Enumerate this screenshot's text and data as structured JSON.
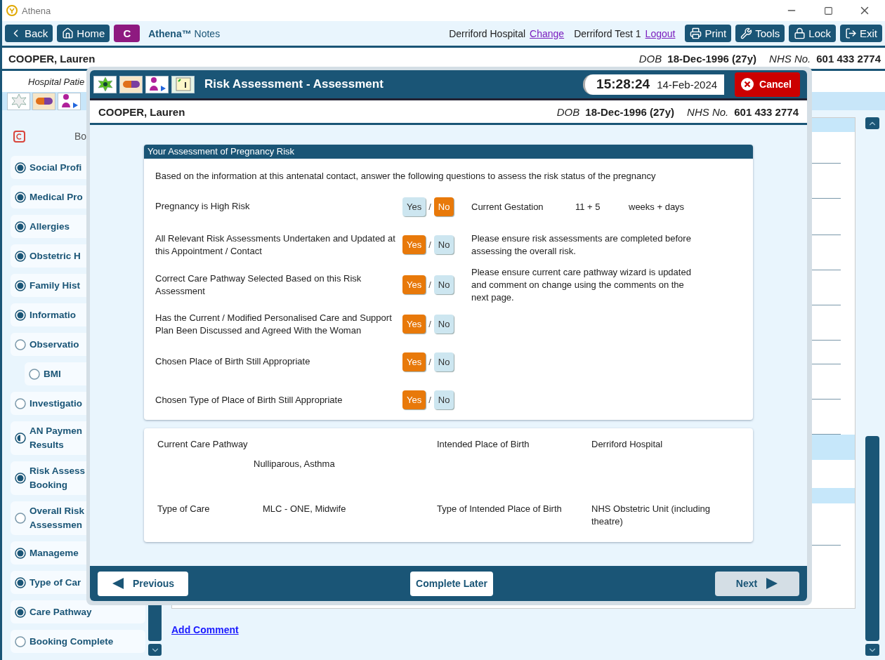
{
  "window": {
    "title": "Athena"
  },
  "toolbar": {
    "left_buttons": [
      {
        "label": "Back",
        "kind": "back"
      },
      {
        "label": "Home",
        "kind": "home"
      },
      {
        "label": "C",
        "kind": "letter"
      }
    ],
    "app_name": "**Athena™** Notes",
    "site": "Derriford Hospital",
    "site_link": "Change",
    "user": "Derriford Test 1",
    "user_link": "Logout",
    "right_buttons": [
      {
        "label": "Print",
        "kind": "print"
      },
      {
        "label": "Tools",
        "kind": "tools"
      },
      {
        "label": "Lock",
        "kind": "lock"
      },
      {
        "label": "Exit",
        "kind": "exit"
      }
    ]
  },
  "patient": {
    "name": "COOPER, Lauren",
    "dob_label": "DOB",
    "dob": "18-Dec-1996 (27y)",
    "nhs_label": "NHS No.",
    "nhs": "601 433 2774"
  },
  "subheading": "Hospital Patie",
  "sidebar": {
    "heading": "Bo",
    "items": [
      {
        "label": "Social Profi",
        "kind": "done"
      },
      {
        "label": "Medical Pro",
        "kind": "done"
      },
      {
        "label": "Allergies",
        "kind": "done"
      },
      {
        "label": "Obstetric H",
        "kind": "done"
      },
      {
        "label": "Family Hist",
        "kind": "done"
      },
      {
        "label": "Informatio",
        "kind": "done"
      },
      {
        "label": "Observatio",
        "kind": "empty",
        "children": [
          {
            "label": "BMI",
            "kind": "empty"
          }
        ]
      },
      {
        "label": "Investigatio",
        "kind": "empty"
      },
      {
        "label": "AN Paymen\nResults",
        "kind": "partial"
      },
      {
        "label": "Risk Assess\nBooking",
        "kind": "done"
      },
      {
        "label": "Overall Risk\nAssessmen",
        "kind": "empty"
      },
      {
        "label": "Manageme",
        "kind": "done"
      },
      {
        "label": "Type of Car",
        "kind": "done"
      },
      {
        "label": "Care Pathway",
        "kind": "done"
      },
      {
        "label": "Booking Complete",
        "kind": "empty"
      }
    ]
  },
  "add_comment": "Add Comment",
  "dialog": {
    "title": "Risk Assessment - Assessment",
    "time": "15:28:24",
    "date": "14-Feb-2024",
    "cancel": "Cancel",
    "patient": {
      "name": "COOPER, Lauren",
      "dob_label": "DOB",
      "dob": "18-Dec-1996 (27y)",
      "nhs_label": "NHS No.",
      "nhs": "601 433 2774"
    },
    "assessment": {
      "title": "Your Assessment of Pregnancy Risk",
      "intro": "Based on the information at this antenatal contact, answer the following questions to assess the risk status of the pregnancy",
      "questions": [
        {
          "label": "Pregnancy is High Risk",
          "separator": "/",
          "options": [
            {
              "label": "Yes",
              "selected": false
            },
            {
              "label": "No",
              "selected": true
            }
          ],
          "gestation": {
            "label": "Current Gestation",
            "value": "11 + 5",
            "unit": "weeks + days"
          }
        },
        {
          "label": "All Relevant Risk Assessments Undertaken and Updated at this Appointment / Contact",
          "separator": "/",
          "options": [
            {
              "label": "Yes",
              "selected": true
            },
            {
              "label": "No",
              "selected": false
            }
          ],
          "note": "Please ensure risk assessments are completed before assessing the overall risk."
        },
        {
          "label": "Correct Care Pathway Selected Based on this Risk Assessment",
          "separator": "/",
          "options": [
            {
              "label": "Yes",
              "selected": true
            },
            {
              "label": "No",
              "selected": false
            }
          ],
          "note": "Please ensure current care pathway wizard is updated and comment on change using the comments on the next page."
        },
        {
          "label": "Has the Current / Modified Personalised Care and Support Plan Been Discussed and Agreed With the Woman",
          "separator": "/",
          "options": [
            {
              "label": "Yes",
              "selected": true
            },
            {
              "label": "No",
              "selected": false
            }
          ]
        },
        {
          "label": "Chosen Place of Birth Still Appropriate",
          "separator": "/",
          "options": [
            {
              "label": "Yes",
              "selected": true
            },
            {
              "label": "No",
              "selected": false
            }
          ]
        },
        {
          "label": "Chosen Type of Place of Birth Still Appropriate",
          "separator": "/",
          "options": [
            {
              "label": "Yes",
              "selected": true
            },
            {
              "label": "No",
              "selected": false
            }
          ]
        }
      ]
    },
    "summary": [
      {
        "left": {
          "label": "Current Care Pathway",
          "value": "Nulliparous, Asthma"
        },
        "right": {
          "label": "Intended Place of Birth",
          "value": "Derriford Hospital"
        }
      },
      {
        "left": {
          "label": "Type of Care",
          "value": "MLC - ONE, Midwife"
        },
        "right": {
          "label": "Type of  Intended Place of Birth",
          "value": "NHS Obstetric Unit (including theatre)"
        }
      }
    ],
    "nav_buttons": [
      {
        "label": "Previous",
        "kind": "previous",
        "disabled": false
      },
      {
        "label": "Complete Later",
        "kind": "later",
        "disabled": false
      },
      {
        "label": "Next",
        "kind": "next",
        "disabled": true
      }
    ]
  }
}
